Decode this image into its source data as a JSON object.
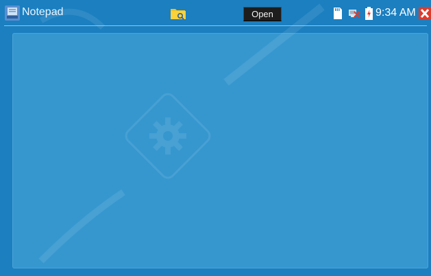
{
  "window": {
    "title": "Notepad",
    "open_label": "Open"
  },
  "status": {
    "time": "9:34 AM"
  },
  "notepad": {
    "content": ""
  },
  "icons": {
    "app": "notepad-app-icon",
    "folder": "folder-search-icon",
    "sd": "sd-card-icon",
    "network": "network-disconnected-icon",
    "battery": "battery-charging-icon",
    "close": "close-icon"
  },
  "colors": {
    "background": "#1b7fc0",
    "text_area": "#3697cf",
    "close": "#e03a2a"
  }
}
